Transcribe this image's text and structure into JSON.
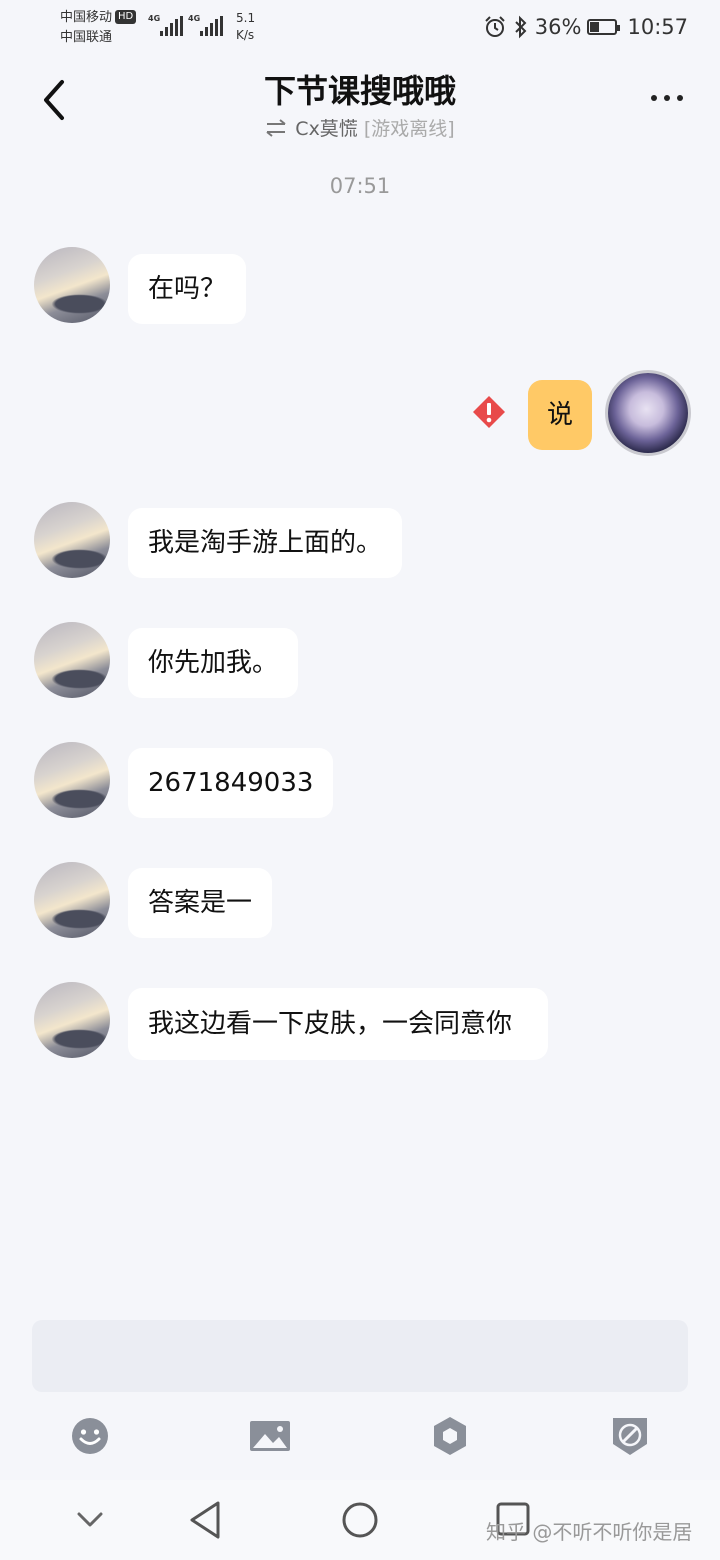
{
  "status_bar": {
    "carrier1": "中国移动",
    "carrier1_badge": "HD",
    "carrier2": "中国联通",
    "sig1_label": "4G",
    "sig2_label": "4G",
    "speed_value": "5.1",
    "speed_unit": "K/s",
    "battery": "36%",
    "time": "10:57",
    "icons": [
      "alarm-icon",
      "bluetooth-icon",
      "battery-icon"
    ]
  },
  "header": {
    "title": "下节课搜哦哦",
    "subtitle_name": "Cx莫慌",
    "subtitle_status": "[游戏离线]"
  },
  "chat": {
    "timestamp": "07:51",
    "messages": [
      {
        "side": "left",
        "text": "在吗？"
      },
      {
        "side": "right",
        "text": "说",
        "failed": true
      },
      {
        "side": "left",
        "text": "我是淘手游上面的。"
      },
      {
        "side": "left",
        "text": "你先加我。"
      },
      {
        "side": "left",
        "text": "2671849033"
      },
      {
        "side": "left",
        "text": "答案是一"
      },
      {
        "side": "left",
        "text": "我这边看一下皮肤，一会同意你"
      }
    ]
  },
  "input": {
    "value": ""
  },
  "toolbar": [
    "emoji-icon",
    "image-icon",
    "shield-icon",
    "compass-icon"
  ],
  "nav": [
    "collapse-icon",
    "back-triangle-icon",
    "home-circle-icon",
    "recents-square-icon"
  ],
  "watermark": "知乎 @不听不听你是居",
  "colors": {
    "sent_bubble": "#ffc966",
    "error": "#e84a4a",
    "background": "#f5f6fa"
  }
}
